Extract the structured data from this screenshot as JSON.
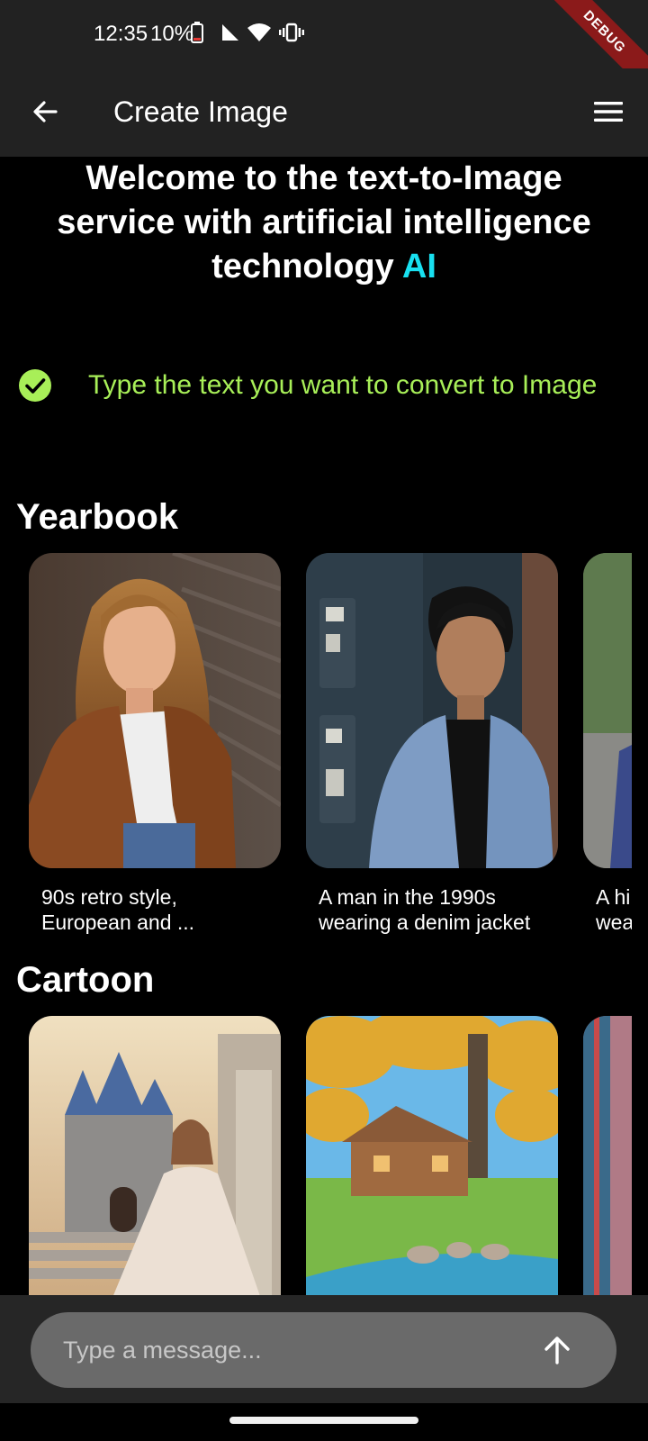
{
  "status_bar": {
    "time": "12:35",
    "battery": "10%"
  },
  "debug_banner": "DEBUG",
  "app_bar": {
    "title": "Create Image"
  },
  "welcome": {
    "text": "Welcome to the text-to-Image service with artificial intelligence technology ",
    "highlight": "AI",
    "highlight_color": "#18e0f0"
  },
  "instruction": {
    "text": "Type the text you want to convert to Image",
    "color": "#a8ef58"
  },
  "sections": [
    {
      "title": "Yearbook",
      "cards": [
        {
          "caption": "90s retro style,\nEuropean and ..."
        },
        {
          "caption": "A man in the 1990s\nwearing a denim jacket"
        },
        {
          "caption": "A hi\nwea"
        }
      ]
    },
    {
      "title": "Cartoon",
      "cards": [
        {
          "caption": ""
        },
        {
          "caption": ""
        },
        {
          "caption": ""
        }
      ]
    }
  ],
  "composer": {
    "placeholder": "Type a message..."
  }
}
